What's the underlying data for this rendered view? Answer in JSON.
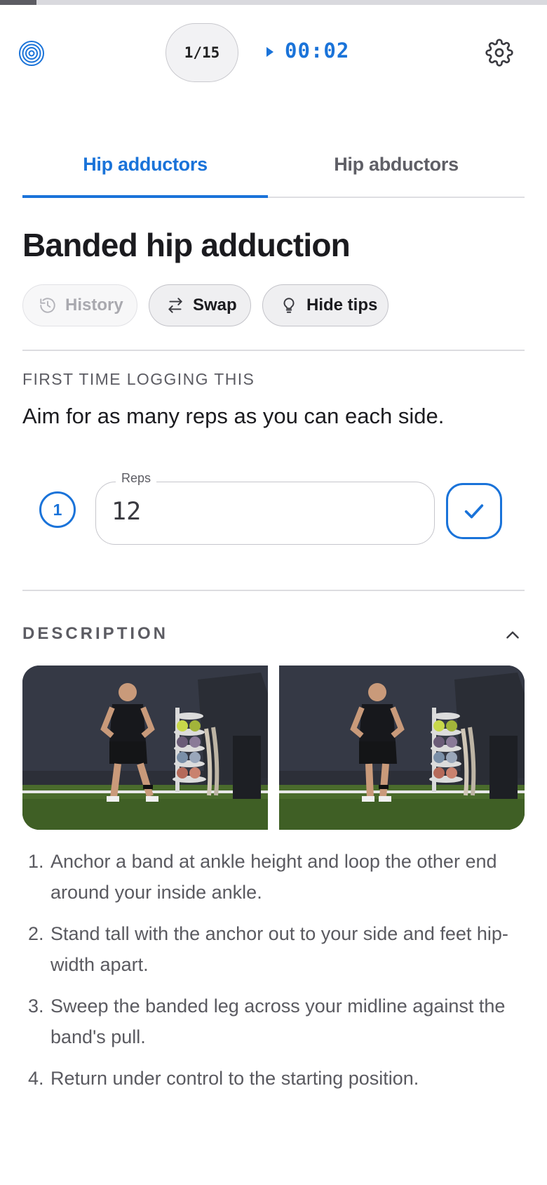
{
  "header": {
    "progress_fraction": 0.067,
    "counter": "1/15",
    "timer": "00:02"
  },
  "tabs": [
    {
      "label": "Hip adductors",
      "active": true
    },
    {
      "label": "Hip abductors",
      "active": false
    }
  ],
  "exercise": {
    "title": "Banded hip adduction",
    "actions": {
      "history": "History",
      "swap": "Swap",
      "hide_tips": "Hide tips"
    },
    "first_time_label": "FIRST TIME LOGGING THIS",
    "instruction": "Aim for as many reps as you can each side."
  },
  "set": {
    "number": "1",
    "reps_label": "Reps",
    "reps_value": "12"
  },
  "description": {
    "heading": "DESCRIPTION",
    "steps": [
      {
        "num": "1.",
        "text": "Anchor a band at ankle height and loop the other end around your inside ankle."
      },
      {
        "num": "2.",
        "text": "Stand tall with the anchor out to your side and feet hip-width apart."
      },
      {
        "num": "3.",
        "text": "Sweep the banded leg across your midline against the band's pull."
      },
      {
        "num": "4.",
        "text": "Return under control to the starting position."
      }
    ]
  },
  "colors": {
    "accent": "#1a73d9",
    "text_primary": "#1b1b1f",
    "text_secondary": "#5c5c63"
  },
  "icons": [
    "logo-icon",
    "play-icon",
    "gear-icon",
    "history-icon",
    "swap-icon",
    "lightbulb-icon",
    "check-icon",
    "chevron-up-icon"
  ]
}
